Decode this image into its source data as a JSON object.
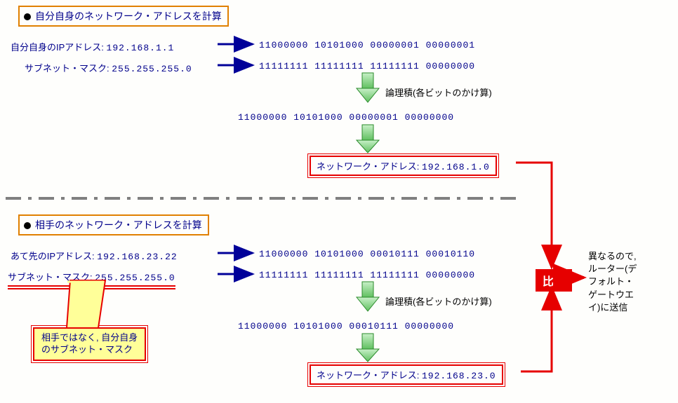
{
  "section1": {
    "title": "自分自身のネットワーク・アドレスを計算",
    "ip_label": "自分自身のIPアドレス:",
    "ip_value": "192.168.1.1",
    "ip_binary": "11000000 10101000 00000001 00000001",
    "mask_label": "サブネット・マスク:",
    "mask_value": "255.255.255.0",
    "mask_binary": "11111111 11111111 11111111 00000000",
    "and_label": "論理積(各ビットのかけ算)",
    "and_result_binary": "11000000 10101000 00000001 00000000",
    "network_label": "ネットワーク・アドレス:",
    "network_value": "192.168.1.0"
  },
  "section2": {
    "title": "相手のネットワーク・アドレスを計算",
    "ip_label": "あて先のIPアドレス:",
    "ip_value": "192.168.23.22",
    "ip_binary": "11000000 10101000 00010111 00010110",
    "mask_label": "サブネット・マスク:",
    "mask_value": "255.255.255.0",
    "mask_binary": "11111111 11111111 11111111 00000000",
    "and_label": "論理積(各ビットのかけ算)",
    "and_result_binary": "11000000 10101000 00010111 00000000",
    "network_label": "ネットワーク・アドレス:",
    "network_value": "192.168.23.0"
  },
  "note": {
    "line1": "相手ではなく, 自分自身",
    "line2": "のサブネット・マスク"
  },
  "compare": {
    "label": "比較",
    "result_line1": "異なるので,",
    "result_line2": "ルーター(デ",
    "result_line3": "フォルト・",
    "result_line4": "ゲートウエ",
    "result_line5": "イ)に送信"
  },
  "colors": {
    "blue": "#000099",
    "red": "#e60000",
    "orange": "#e08000",
    "green": "#33aa33",
    "grey": "#808080"
  }
}
